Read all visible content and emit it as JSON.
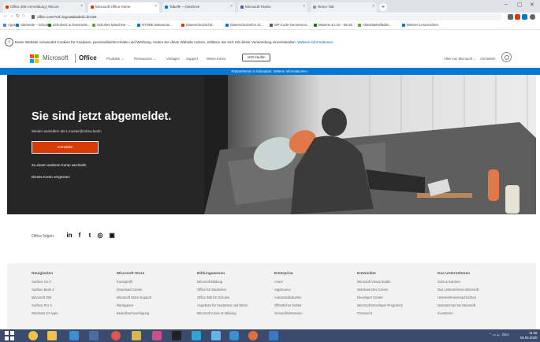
{
  "browser": {
    "tabs": [
      {
        "label": "Office 365-Anmeldung | Micros",
        "color": "#d83b01",
        "active": false
      },
      {
        "label": "Microsoft Office Home",
        "color": "#d83b01",
        "active": true
      },
      {
        "label": "Tabelle – OneDrive",
        "color": "#0078d4",
        "active": false
      },
      {
        "label": "Microsoft Teams",
        "color": "#5558af",
        "active": false
      },
      {
        "label": "Neuer Tab",
        "color": "#999999",
        "active": false
      }
    ],
    "url": "office.com/?ref=logout&lwdeid=de-DE",
    "bookmarks": [
      {
        "label": "Apps",
        "color": "#4285f4"
      },
      {
        "label": "Startseite – Schulen...",
        "color": "#0078d4"
      },
      {
        "label": "Schulnetz & Gemeinde...",
        "color": "#107c10"
      },
      {
        "label": "Schulnet Maschine -...",
        "color": "#6b9e2d"
      },
      {
        "label": "NTNNE Bekanntm...",
        "color": "#0078d4"
      },
      {
        "label": "Datenschutzrichtl...",
        "color": "#d83b01"
      },
      {
        "label": "Datenschutzinfos Sc...",
        "color": "#0078d4"
      },
      {
        "label": "MP-Code-Generierun...",
        "color": "#555555"
      },
      {
        "label": "Maxime & Linz - BLUE",
        "color": "#107c10"
      },
      {
        "label": "Aktivitätsleitfaden...",
        "color": "#6b9e2d"
      },
      {
        "label": "Weitere Lesezeichen",
        "color": "#0078d4"
      }
    ]
  },
  "cookie": {
    "text": "Diese Website verwendet Cookies für Analysen, personalisierte Inhalte und Werbung. Indem Sie diese Website nutzen, erklären Sie sich mit dieser Verwendung einverstanden.",
    "link": "Weitere Informationen"
  },
  "header": {
    "brand": "Microsoft",
    "product": "Office",
    "nav": [
      "Produkte ⌄",
      "Ressourcen ⌄",
      "Vorlagen",
      "Support",
      "Meine Konto"
    ],
    "cta": "Jetzt kaufen",
    "all_ms": "Alles von Microsoft ⌄",
    "signin": "Anmelden"
  },
  "promo": "Partnertermin in Education: Weitere Informationen ›",
  "hero": {
    "title": "Sie sind jetzt abgemeldet.",
    "subtitle": "Wieder anmelden als k.muster@mbsu.berlin",
    "button": "Anmelden",
    "link_other": "Zu einem anderen Konto wechseln",
    "link_forget": "Dieses Konto vergessen"
  },
  "follow": {
    "label": "Office folgen",
    "icons": [
      "in",
      "f",
      "t",
      "◎",
      "▣"
    ]
  },
  "footer": {
    "columns": [
      {
        "head": "Neuigkeiten",
        "items": [
          "Surface Go 2",
          "Surface Book 3",
          "Microsoft 365",
          "Surface Pro X",
          "Windows 10 Apps"
        ]
      },
      {
        "head": "Microsoft Store",
        "items": [
          "Kontoprofil",
          "Download Center",
          "Microsoft Store-Support",
          "Rückgaben",
          "Bestellnachverfolgung"
        ]
      },
      {
        "head": "Bildungswesen",
        "items": [
          "Microsoft Bildung",
          "Office für Studenten",
          "Office 365 für Schulen",
          "Angebote für Studenten und Eltern",
          "Microsoft Azure im Bildung"
        ]
      },
      {
        "head": "Enterprise",
        "items": [
          "Azure",
          "AppSource",
          "Automobilindustrie",
          "Öffentlicher Sektor",
          "Gesundheitswesen"
        ]
      },
      {
        "head": "Entwickler",
        "items": [
          "Microsoft Visual Studio",
          "Windows Dev Center",
          "Developer Center",
          "Microsoft Developer Programm",
          "Channel 9"
        ]
      },
      {
        "head": "Das Unternehmen",
        "items": [
          "Jobs & Karriere",
          "Das Unternehmen Microsoft",
          "Unternehmensnachrichten",
          "Datenschutz bei Microsoft",
          "Investoren"
        ]
      }
    ]
  },
  "taskbar": {
    "tray": "⌃ ▭ 🔈 DEU",
    "time": "11:25",
    "date": "05.06.2020"
  }
}
